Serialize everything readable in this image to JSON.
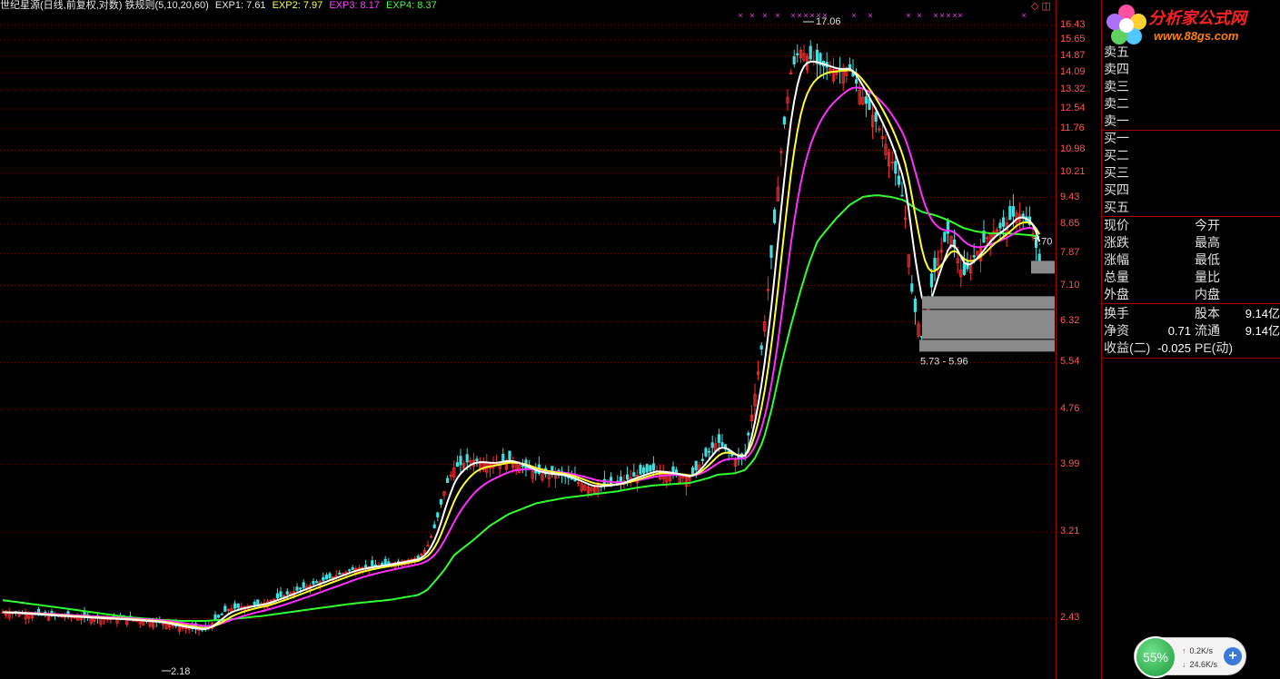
{
  "header": {
    "title": "世纪星源(日线,前复权,对数) 铁规则(5,10,20,60)",
    "exp1": "EXP1: 7.61",
    "exp2": "EXP2: 7.97",
    "exp3": "EXP3: 8.17",
    "exp4": "EXP4: 8.37"
  },
  "top_icons": "◇ ◫",
  "logo": {
    "text": "分析家公式网",
    "url": "www.88gs.com"
  },
  "chart_data": {
    "type": "candlestick",
    "title": "世纪星源(日线,前复权,对数)",
    "y_scale": "log",
    "ylim": [
      2.3,
      17.3
    ],
    "y_ticks": [
      "16.43",
      "15.65",
      "14.87",
      "14.09",
      "13.32",
      "12.54",
      "11.76",
      "10.98",
      "10.21",
      "9.43",
      "8.65",
      "7.87",
      "7.10",
      "6.32",
      "5.54",
      "4.76",
      "3.99",
      "3.21",
      "2.43"
    ],
    "annotations": {
      "high_label": "17.06",
      "low_label": "2.18",
      "range_label": "5.73 - 5.96",
      "last_label": "7.70"
    },
    "series_colors": {
      "EXP1": "#ffffff",
      "EXP2": "#ffff30",
      "EXP3": "#ff30ff",
      "EXP4": "#30ff30",
      "up": "#ff3030",
      "down": "#40e0e0"
    },
    "anchors": {
      "x": [
        0,
        60,
        110,
        140,
        175,
        200,
        225,
        250,
        290,
        340,
        390,
        430,
        460,
        470,
        480,
        490,
        500,
        520,
        540,
        560,
        590,
        620,
        650,
        680,
        700,
        720,
        760,
        780,
        790,
        810,
        820,
        830,
        840,
        850,
        860,
        870,
        880,
        890,
        900,
        920,
        935,
        950,
        965,
        980,
        995,
        1005,
        1015,
        1030,
        1045,
        1060,
        1075,
        1090,
        1105,
        1120,
        1135,
        1145
      ],
      "close": [
        2.48,
        2.45,
        2.43,
        2.42,
        2.4,
        2.36,
        2.34,
        2.5,
        2.55,
        2.7,
        2.85,
        2.9,
        2.95,
        3.05,
        3.3,
        3.7,
        3.95,
        4.05,
        4.0,
        4.05,
        3.88,
        3.85,
        3.7,
        3.75,
        3.85,
        3.92,
        3.82,
        4.15,
        4.3,
        4.05,
        4.1,
        4.9,
        6.0,
        8.0,
        11.0,
        14.0,
        15.2,
        14.8,
        14.5,
        14.2,
        14.3,
        13.0,
        12.0,
        10.8,
        9.3,
        6.7,
        6.0,
        7.6,
        8.5,
        7.3,
        7.9,
        8.4,
        8.6,
        9.0,
        8.6,
        7.6
      ],
      "ema60": [
        2.58,
        2.52,
        2.47,
        2.44,
        2.42,
        2.41,
        2.41,
        2.42,
        2.45,
        2.5,
        2.55,
        2.58,
        2.62,
        2.66,
        2.75,
        2.85,
        2.98,
        3.12,
        3.28,
        3.4,
        3.52,
        3.58,
        3.62,
        3.66,
        3.7,
        3.73,
        3.76,
        3.82,
        3.86,
        3.88,
        3.92,
        4.05,
        4.3,
        4.8,
        5.5,
        6.2,
        6.9,
        7.6,
        8.2,
        8.8,
        9.2,
        9.45,
        9.5,
        9.45,
        9.35,
        9.15,
        9.0,
        8.9,
        8.75,
        8.55,
        8.45,
        8.4,
        8.4,
        8.38,
        8.35,
        8.3
      ]
    }
  },
  "quote_panel": {
    "sell": [
      "卖五",
      "卖四",
      "卖三",
      "卖二",
      "卖一"
    ],
    "buy": [
      "买一",
      "买二",
      "买三",
      "买四",
      "买五"
    ],
    "stats_left": [
      "现价",
      "涨跌",
      "涨幅",
      "总量",
      "外盘"
    ],
    "stats_right": [
      "今开",
      "最高",
      "最低",
      "量比",
      "内盘"
    ],
    "extra": [
      {
        "label": "换手",
        "value": "",
        "label2": "股本",
        "value2": "9.14亿"
      },
      {
        "label": "净资",
        "value": "0.71",
        "label2": "流通",
        "value2": "9.14亿"
      },
      {
        "label": "收益(二)",
        "value": "-0.025",
        "label2": "PE(动)",
        "value2": ""
      }
    ]
  },
  "net_widget": {
    "percent": "55%",
    "up": "0.2K/s",
    "down": "24.6K/s",
    "add": "+"
  }
}
